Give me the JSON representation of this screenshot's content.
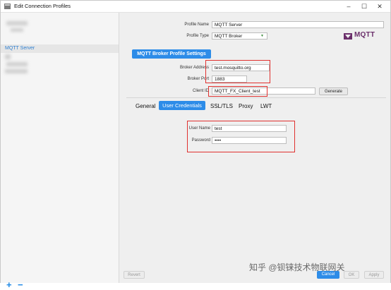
{
  "window": {
    "title": "Edit Connection Profiles"
  },
  "sidebar": {
    "items": [
      {
        "label": "MQTT Server"
      }
    ],
    "add_label": "+",
    "remove_label": "−"
  },
  "form": {
    "profile_name_label": "Profile Name",
    "profile_name_value": "MQTT Server",
    "profile_type_label": "Profile Type",
    "profile_type_value": "MQTT Broker",
    "logo_text": "MQTT",
    "section_title": "MQTT Broker Profile Settings",
    "broker_address_label": "Broker Address",
    "broker_address_value": "test.mosquitto.org",
    "broker_port_label": "Broker Port",
    "broker_port_value": "1883",
    "client_id_label": "Client ID",
    "client_id_value": "MQTT_FX_Client_test",
    "generate_label": "Generate"
  },
  "tabs": [
    {
      "label": "General"
    },
    {
      "label": "User Credentials",
      "active": true
    },
    {
      "label": "SSL/TLS"
    },
    {
      "label": "Proxy"
    },
    {
      "label": "LWT"
    }
  ],
  "credentials": {
    "user_name_label": "User Name",
    "user_name_value": "test",
    "password_label": "Password",
    "password_value": "••••"
  },
  "footer": {
    "revert_label": "Revert",
    "cancel_label": "Cancel",
    "ok_label": "OK",
    "apply_label": "Apply"
  },
  "watermark": "知乎 @钡铼技术物联网关",
  "colors": {
    "accent": "#2d8ce8",
    "highlight": "#e0312f",
    "logo": "#6b2f6b"
  }
}
